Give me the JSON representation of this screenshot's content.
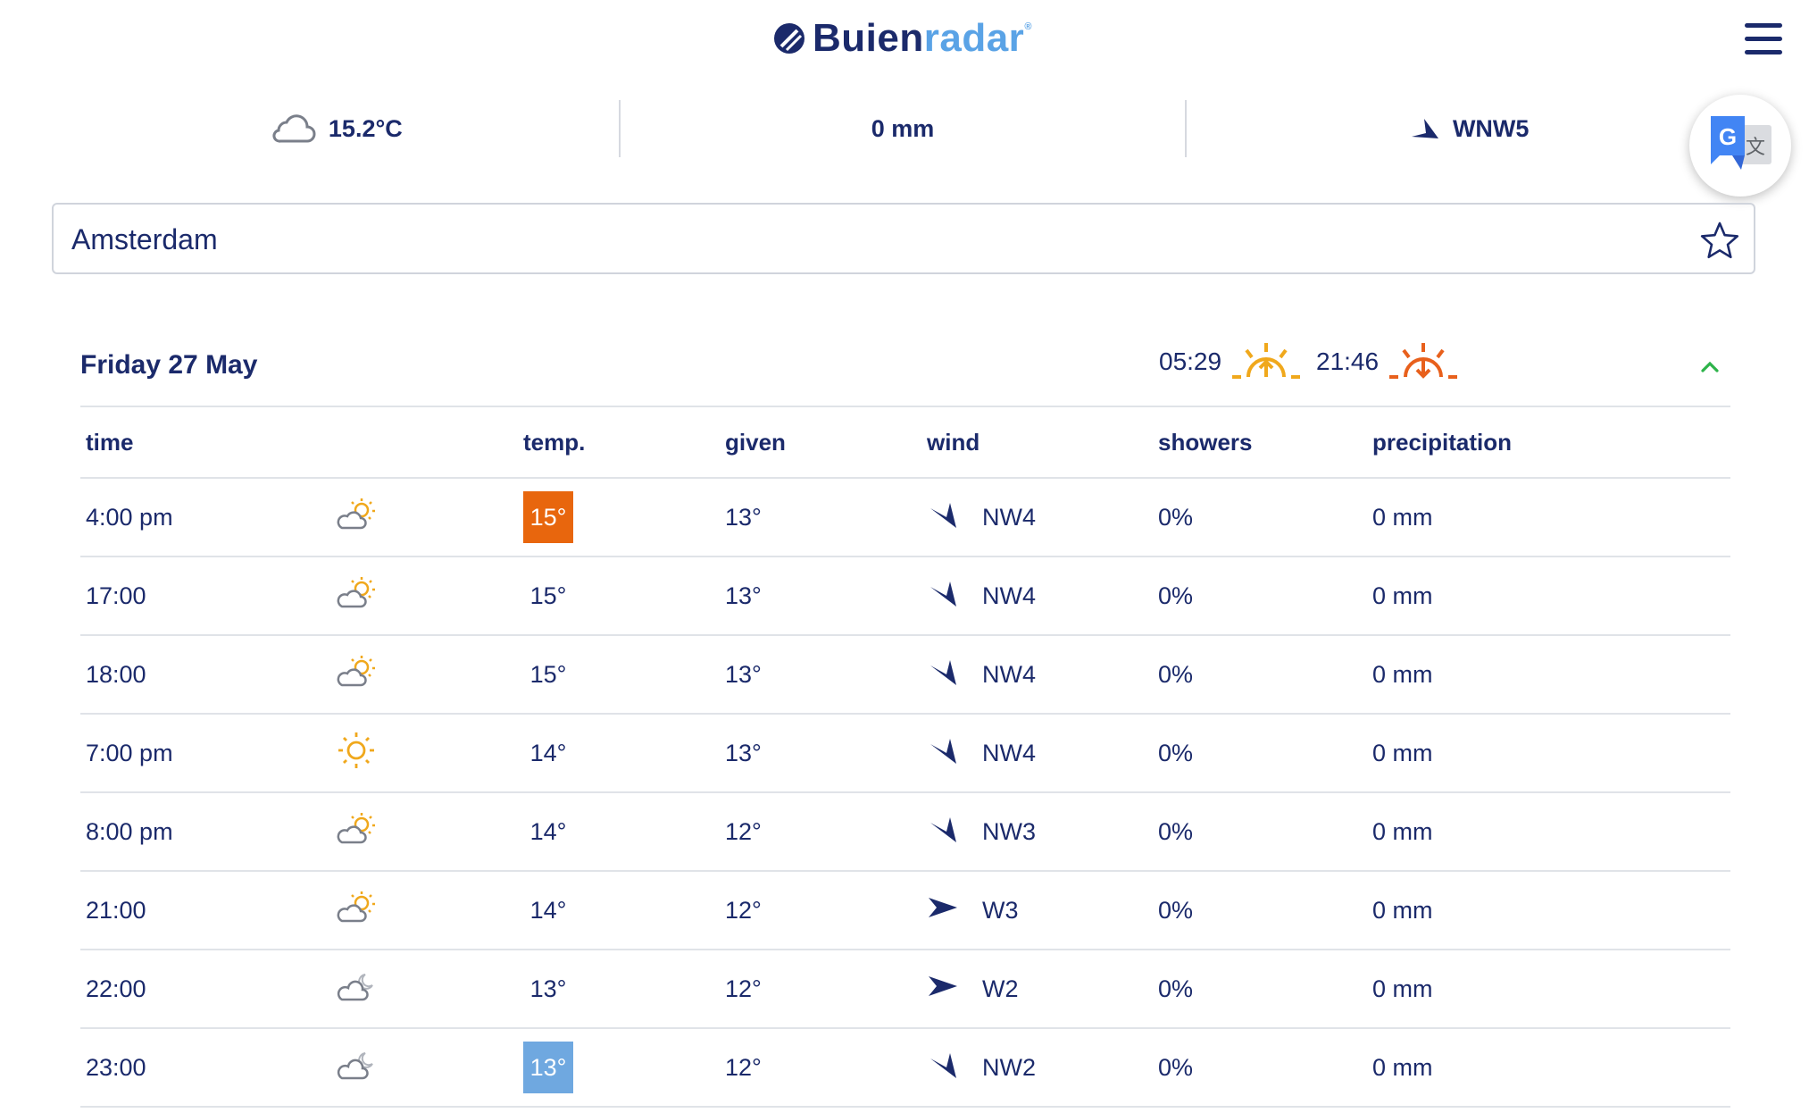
{
  "header": {
    "brand_part1": "Buien",
    "brand_part2": "radar",
    "brand_mark": "®"
  },
  "current": {
    "temperature": "15.2°C",
    "precipitation": "0 mm",
    "wind": "WNW5",
    "temperature_icon": "cloud-icon",
    "wind_icon": "wind-arrow-icon"
  },
  "search": {
    "value": "Amsterdam"
  },
  "day": {
    "title": "Friday 27 May",
    "sunrise": "05:29",
    "sunset": "21:46"
  },
  "table": {
    "headers": {
      "time": "time",
      "temp": "temp.",
      "given": "given",
      "wind": "wind",
      "showers": "showers",
      "precipitation": "precipitation"
    },
    "rows": [
      {
        "time": "4:00 pm",
        "icon": "partly-cloudy-day-icon",
        "temp": "15°",
        "given": "13°",
        "wind": "NW4",
        "wind_dir": "NW",
        "showers": "0%",
        "precip": "0 mm",
        "highlight": "max"
      },
      {
        "time": "17:00",
        "icon": "partly-cloudy-day-icon",
        "temp": "15°",
        "given": "13°",
        "wind": "NW4",
        "wind_dir": "NW",
        "showers": "0%",
        "precip": "0 mm",
        "highlight": ""
      },
      {
        "time": "18:00",
        "icon": "partly-cloudy-day-icon",
        "temp": "15°",
        "given": "13°",
        "wind": "NW4",
        "wind_dir": "NW",
        "showers": "0%",
        "precip": "0 mm",
        "highlight": ""
      },
      {
        "time": "7:00 pm",
        "icon": "sun-icon",
        "temp": "14°",
        "given": "13°",
        "wind": "NW4",
        "wind_dir": "NW",
        "showers": "0%",
        "precip": "0 mm",
        "highlight": ""
      },
      {
        "time": "8:00 pm",
        "icon": "partly-cloudy-day-icon",
        "temp": "14°",
        "given": "12°",
        "wind": "NW3",
        "wind_dir": "NW",
        "showers": "0%",
        "precip": "0 mm",
        "highlight": ""
      },
      {
        "time": "21:00",
        "icon": "partly-cloudy-day-icon",
        "temp": "14°",
        "given": "12°",
        "wind": "W3",
        "wind_dir": "W",
        "showers": "0%",
        "precip": "0 mm",
        "highlight": ""
      },
      {
        "time": "22:00",
        "icon": "partly-cloudy-night-icon",
        "temp": "13°",
        "given": "12°",
        "wind": "W2",
        "wind_dir": "W",
        "showers": "0%",
        "precip": "0 mm",
        "highlight": ""
      },
      {
        "time": "23:00",
        "icon": "partly-cloudy-night-icon",
        "temp": "13°",
        "given": "12°",
        "wind": "NW2",
        "wind_dir": "NW",
        "showers": "0%",
        "precip": "0 mm",
        "highlight": "min"
      }
    ]
  },
  "colors": {
    "brand_dark": "#1b2a6b",
    "brand_light": "#5aa3e6",
    "max_temp": "#e8660d",
    "min_temp": "#6fa8e0",
    "sun": "#f0a81c",
    "collapse_arrow": "#2db34a"
  }
}
